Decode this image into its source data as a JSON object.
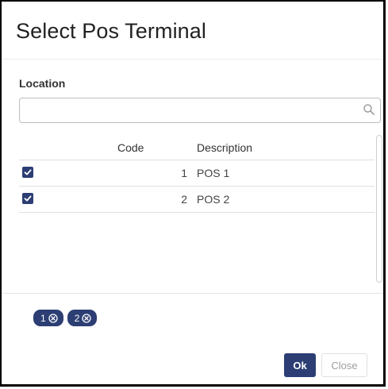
{
  "dialog": {
    "title": "Select Pos Terminal"
  },
  "filter": {
    "label": "Location",
    "value": "",
    "placeholder": "",
    "icon": "search-icon"
  },
  "grid": {
    "columns": {
      "code": "Code",
      "description": "Description"
    },
    "rows": [
      {
        "code": "1",
        "description": "POS 1",
        "checked": true
      },
      {
        "code": "2",
        "description": "POS 2",
        "checked": true
      }
    ]
  },
  "selected_chips": [
    {
      "label": "1",
      "icon": "remove-icon"
    },
    {
      "label": "2",
      "icon": "remove-icon"
    }
  ],
  "buttons": {
    "ok": "Ok",
    "close": "Close"
  },
  "colors": {
    "accent": "#2c3e73",
    "border": "#bdbdbd"
  }
}
